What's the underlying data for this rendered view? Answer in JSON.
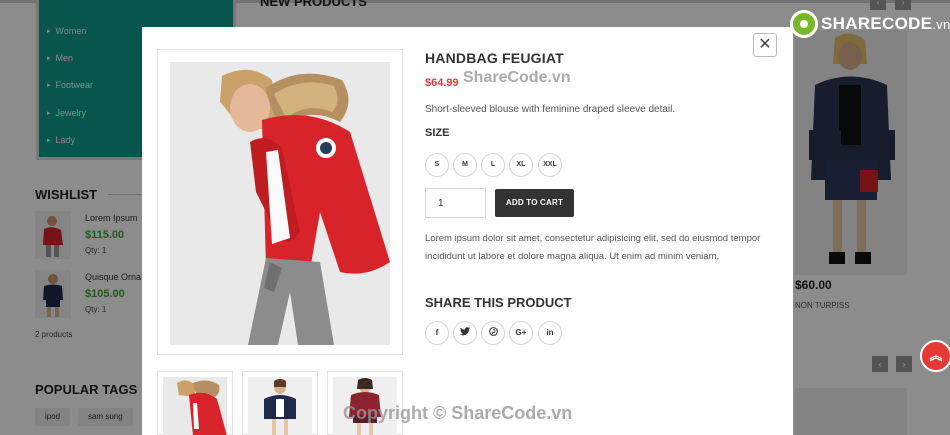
{
  "background": {
    "section_new_products": "NEW PRODUCTS",
    "categories": [
      "Women",
      "Men",
      "Footwear",
      "Jewelry",
      "Lady"
    ],
    "wishlist": {
      "title": "WISHLIST",
      "items": [
        {
          "name": "Lorem Ipsum",
          "price": "$115.00",
          "qty": "Qty: 1"
        },
        {
          "name": "Quisque Orna",
          "price": "$105.00",
          "qty": "Qty: 1"
        }
      ],
      "count": "2 products"
    },
    "popular_tags": {
      "title": "POPULAR TAGS",
      "tags": [
        "ipod",
        "sam sung"
      ]
    },
    "right_product": {
      "price": "$60.00",
      "name": "NON TURPISS"
    }
  },
  "logo": {
    "main": "SHARECODE",
    "suffix": ".vn"
  },
  "watermarks": {
    "top": "ShareCode.vn",
    "bottom": "Copyright © ShareCode.vn"
  },
  "modal": {
    "close_icon": "close-icon",
    "title": "HANDBAG FEUGIAT",
    "price": "$64.99",
    "description": "Short-sleeved blouse with feminine draped sleeve detail.",
    "size_label": "SIZE",
    "sizes": [
      "S",
      "M",
      "L",
      "XL",
      "XXL"
    ],
    "quantity": "1",
    "add_to_cart": "ADD TO CART",
    "lorem": "Lorem ipsum dolor sit amet, consectetur adipisicing elit, sed do eiusmod tempor incididunt ut labore et dolore magna aliqua. Ut enim ad minim veniam,",
    "share_title": "SHARE THIS PRODUCT",
    "share_icons": [
      "facebook-icon",
      "twitter-icon",
      "pinterest-icon",
      "google-plus-icon",
      "linkedin-icon"
    ]
  },
  "colors": {
    "accent_teal": "#0f9b8e",
    "price_red": "#e03d3d",
    "price_green": "#3aa635",
    "jacket_red": "#d8232a",
    "button_dark": "#333333"
  }
}
